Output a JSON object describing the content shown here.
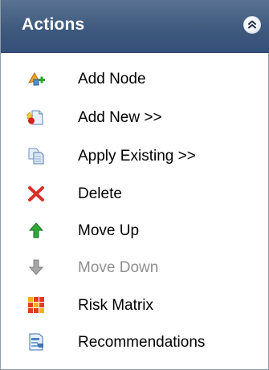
{
  "panel": {
    "title": "Actions",
    "collapse_icon": "double-chevron-up-icon",
    "colors": {
      "header_bg": "#3f5a7e",
      "header_text": "#ffffff",
      "disabled_text": "#8f8f8f"
    }
  },
  "actions": [
    {
      "label": "Add Node",
      "icon": "add-node-icon",
      "enabled": true
    },
    {
      "label": "Add New >>",
      "icon": "add-new-document-icon",
      "enabled": true
    },
    {
      "label": "Apply Existing >>",
      "icon": "copy-documents-icon",
      "enabled": true
    },
    {
      "label": "Delete",
      "icon": "red-x-delete-icon",
      "enabled": true
    },
    {
      "label": "Move Up",
      "icon": "green-arrow-up-icon",
      "enabled": true
    },
    {
      "label": "Move Down",
      "icon": "gray-arrow-down-icon",
      "enabled": false
    },
    {
      "label": "Risk Matrix",
      "icon": "risk-matrix-grid-icon",
      "enabled": true
    },
    {
      "label": "Recommendations",
      "icon": "recommendations-document-icon",
      "enabled": true
    }
  ]
}
